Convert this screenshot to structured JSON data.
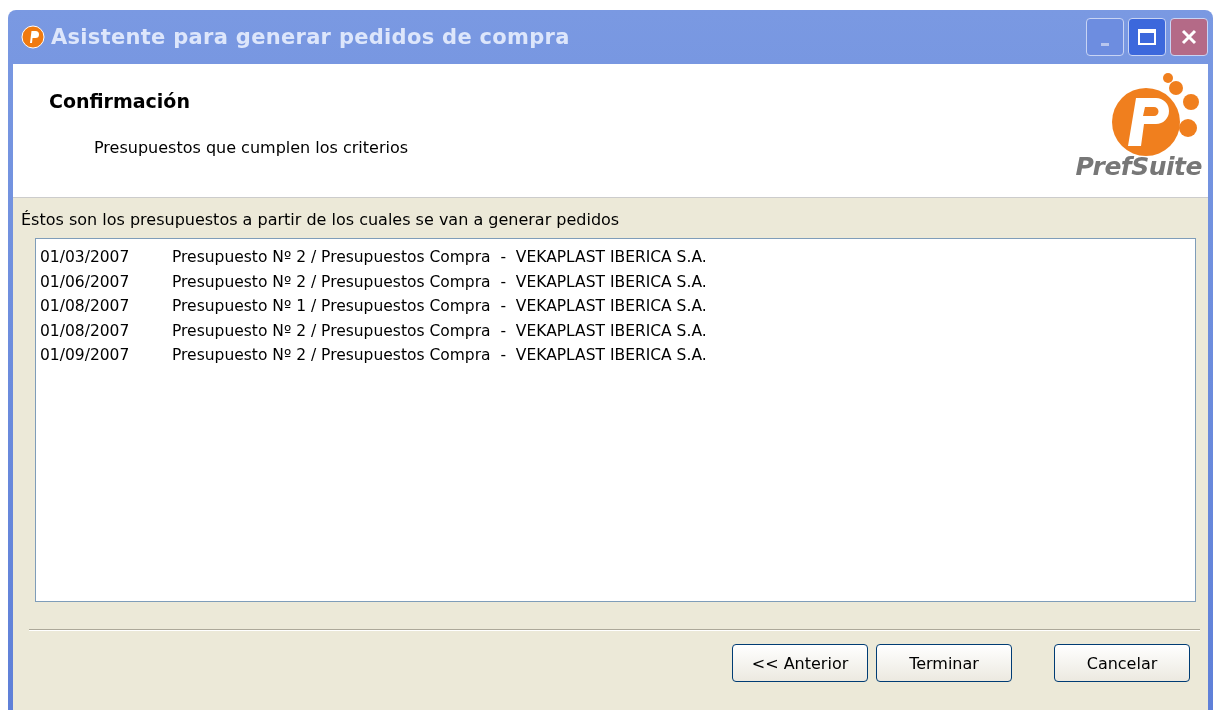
{
  "window": {
    "title": "Asistente para generar pedidos de compra"
  },
  "header": {
    "title": "Confirmación",
    "subtitle": "Presupuestos que cumplen los criterios",
    "logo_text": "PrefSuite"
  },
  "intro": "Éstos son los presupuestos a partir de los cuales se van a generar pedidos",
  "rows": [
    {
      "date": "01/03/2007",
      "text": "Presupuesto Nº 2 / Presupuestos Compra  -  VEKAPLAST IBERICA S.A."
    },
    {
      "date": "01/06/2007",
      "text": "Presupuesto Nº 2 / Presupuestos Compra  -  VEKAPLAST IBERICA S.A."
    },
    {
      "date": "01/08/2007",
      "text": "Presupuesto Nº 1 / Presupuestos Compra  -  VEKAPLAST IBERICA S.A."
    },
    {
      "date": "01/08/2007",
      "text": "Presupuesto Nº 2 / Presupuestos Compra  -  VEKAPLAST IBERICA S.A."
    },
    {
      "date": "01/09/2007",
      "text": "Presupuesto Nº 2 / Presupuestos Compra  -  VEKAPLAST IBERICA S.A."
    }
  ],
  "buttons": [
    "<< Anterior",
    "Terminar",
    "Cancelar"
  ]
}
